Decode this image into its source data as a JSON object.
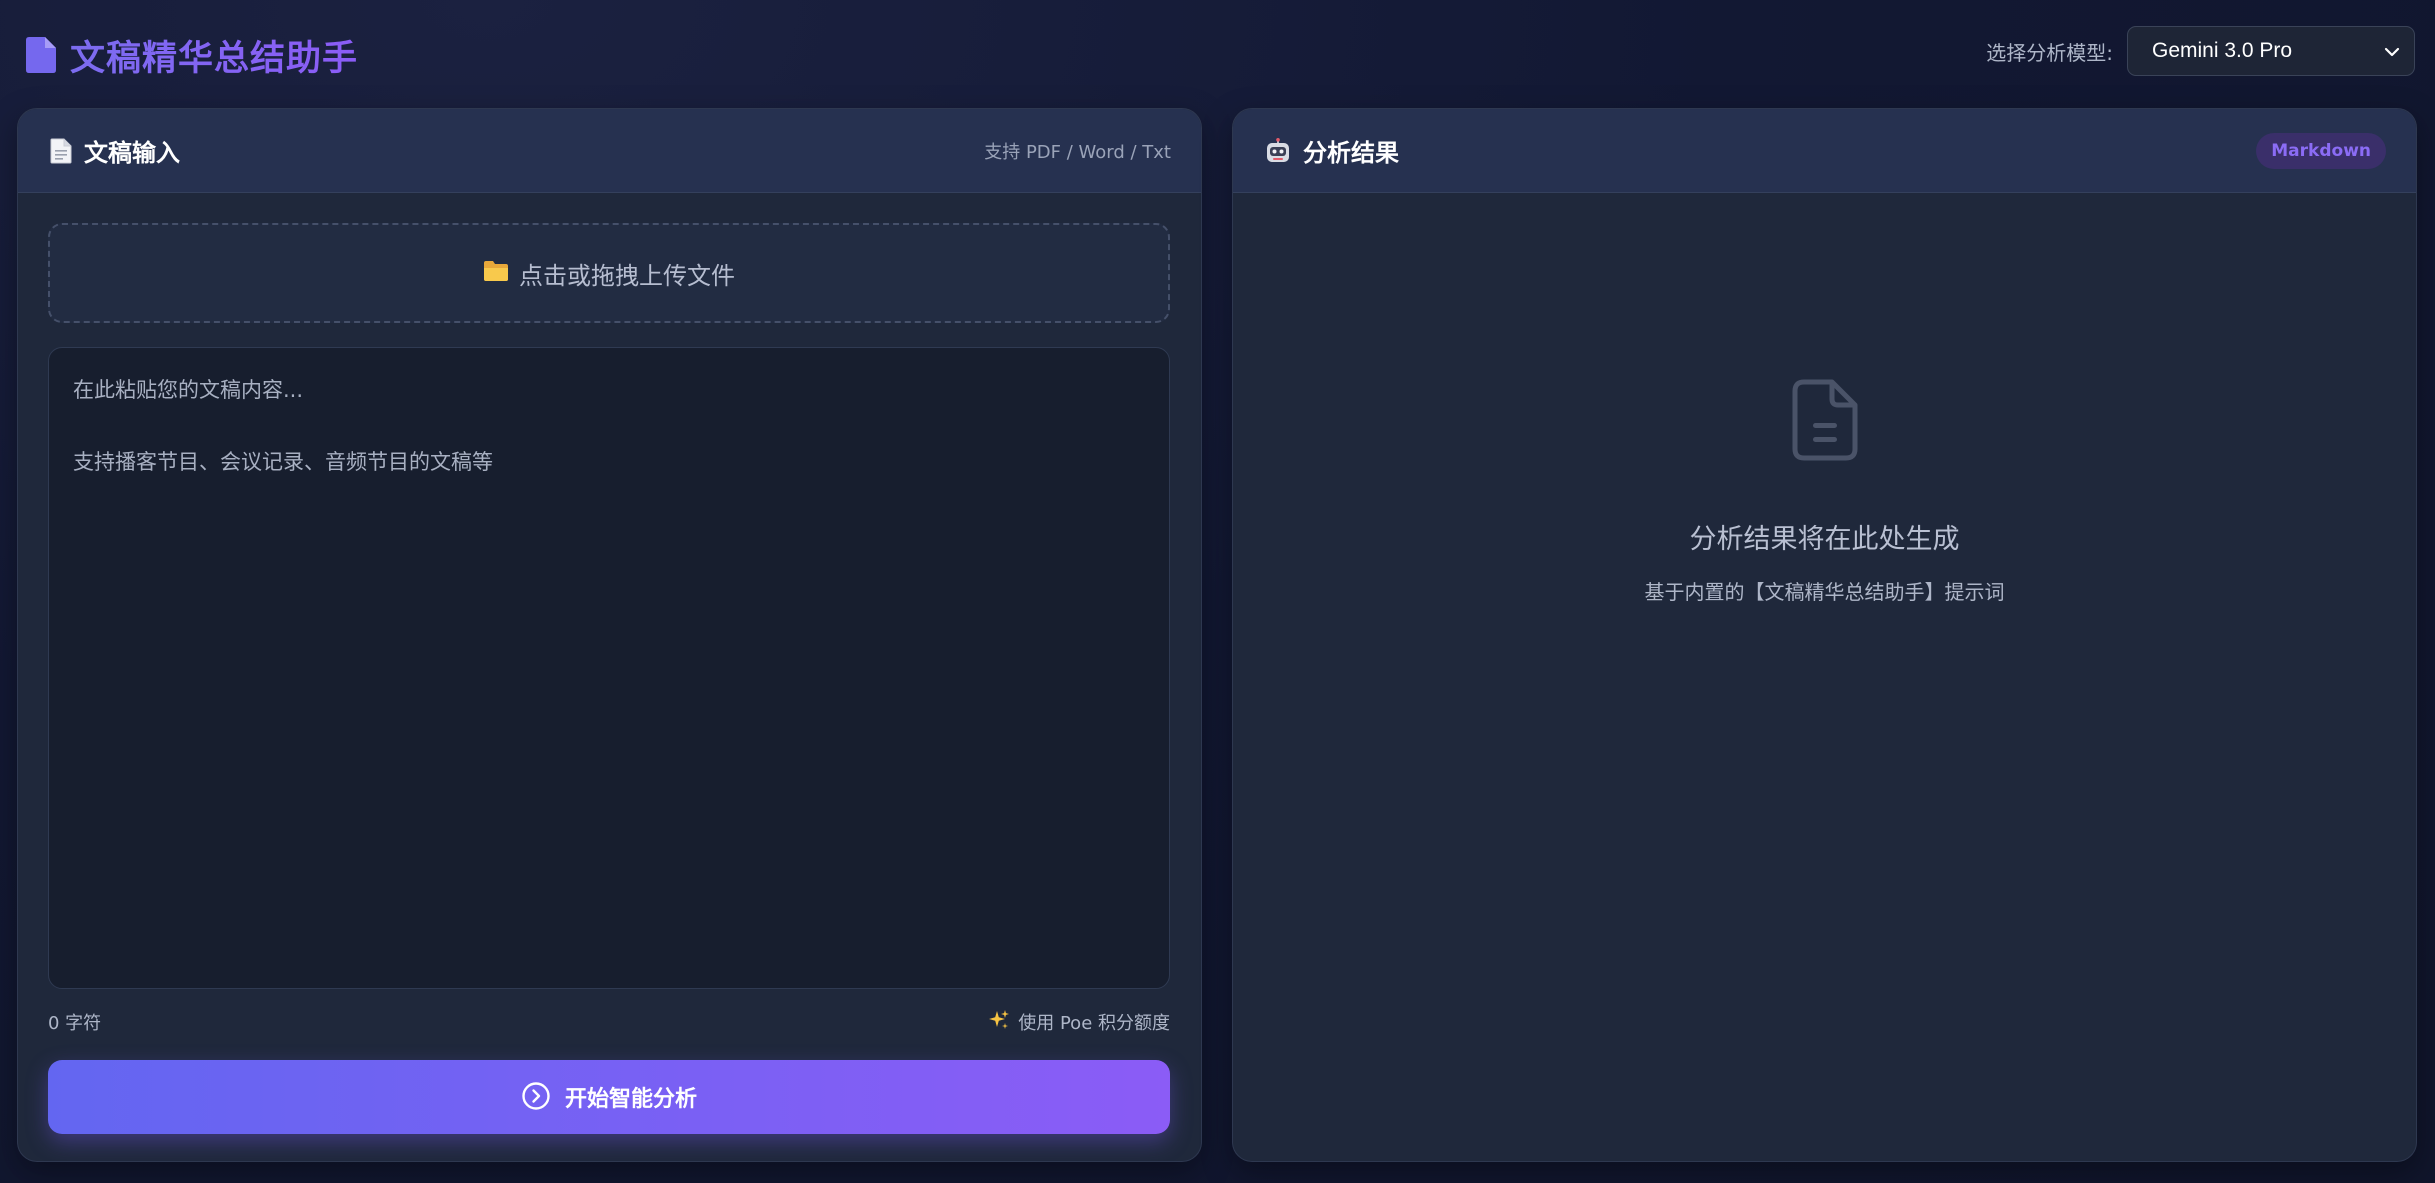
{
  "header": {
    "app_title": "文稿精华总结助手",
    "model_label": "选择分析模型:",
    "model_selected": "Gemini 3.0 Pro"
  },
  "input_panel": {
    "title": "文稿输入",
    "support_text": "支持 PDF / Word / Txt",
    "upload_text": "点击或拖拽上传文件",
    "textarea_placeholder": "在此粘贴您的文稿内容...\n\n支持播客节目、会议记录、音频节目的文稿等",
    "textarea_value": "",
    "char_count": "0 字符",
    "quota_note": "使用 Poe 积分额度",
    "analyze_button": "开始智能分析"
  },
  "result_panel": {
    "title": "分析结果",
    "format_badge": "Markdown",
    "empty_title": "分析结果将在此处生成",
    "empty_subtitle": "基于内置的【文稿精华总结助手】提示词"
  },
  "colors": {
    "accent": "#8b5cf6",
    "accent_start": "#6366f1",
    "background": "#121833",
    "panel": "#1f283b",
    "panel_header": "#263150"
  },
  "icons": {
    "brand": "document-icon",
    "input_panel": "page-icon",
    "result_panel": "robot-icon",
    "upload": "folder-icon",
    "quota": "sparkles-icon",
    "analyze": "circle-arrow-icon",
    "empty_state": "file-text-icon",
    "model_select": "chevron-down-icon"
  }
}
